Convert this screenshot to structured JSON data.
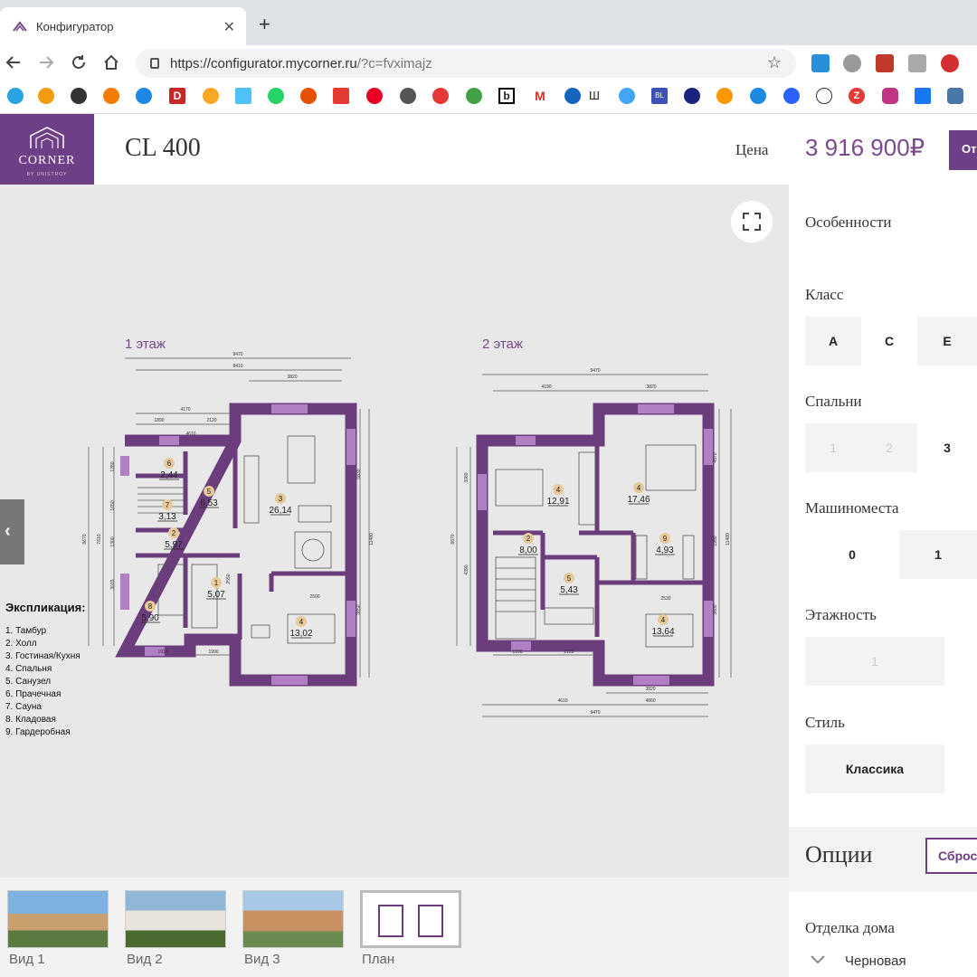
{
  "browser": {
    "tab_title": "Конфигуратор",
    "url_host": "https://configurator.mycorner.ru",
    "url_query": "/?c=fvximajz",
    "new_tab": "+",
    "close": "✕"
  },
  "bookmarks": {
    "letters": [
      "D",
      "b",
      "M",
      "Ш",
      "BL",
      "Z"
    ]
  },
  "header": {
    "logo_brand": "CORNER",
    "logo_by": "BY UNISTROY",
    "model": "CL 400",
    "price_label": "Цена",
    "price_value": "3 916 900₽",
    "send_button": "От"
  },
  "plan": {
    "floor1_label": "1 этаж",
    "floor2_label": "2 этаж",
    "floor1_rooms": [
      {
        "num": "6",
        "area": "2,44"
      },
      {
        "num": "5",
        "area": "6,53"
      },
      {
        "num": "3",
        "area": "26,14"
      },
      {
        "num": "7",
        "area": "3,13"
      },
      {
        "num": "2",
        "area": "5,97"
      },
      {
        "num": "1",
        "area": "5,07"
      },
      {
        "num": "8",
        "area": "5,90"
      },
      {
        "num": "4",
        "area": "13,02"
      }
    ],
    "floor2_rooms": [
      {
        "num": "4",
        "area": "12,91"
      },
      {
        "num": "4",
        "area": "17,46"
      },
      {
        "num": "2",
        "area": "8,00"
      },
      {
        "num": "5",
        "area": "5,43"
      },
      {
        "num": "9",
        "area": "4,93"
      },
      {
        "num": "4",
        "area": "13,64"
      }
    ],
    "floor1_dims": [
      "9470",
      "8410",
      "3820",
      "4170",
      "1890",
      "2120",
      "4610",
      "2550",
      "2500",
      "1910",
      "1990",
      "8670",
      "7610",
      "1280",
      "1650",
      "1300",
      "3015",
      "6630",
      "11480",
      "3650"
    ],
    "floor2_dims": [
      "9470",
      "4190",
      "3820",
      "3080",
      "4390",
      "8670",
      "4570",
      "1950",
      "11480",
      "3600",
      "1990",
      "2120",
      "2530",
      "3820",
      "4610",
      "4860",
      "9470"
    ],
    "explication_title": "Экспликация:",
    "explication": [
      "1. Тамбур",
      "2. Холл",
      "3. Гостиная/Кухня",
      "4. Спальня",
      "5. Санузел",
      "6. Прачечная",
      "7. Сауна",
      "8. Кладовая",
      "9. Гардеробная"
    ],
    "prev_arrow": "‹"
  },
  "thumbnails": [
    {
      "label": "Вид 1"
    },
    {
      "label": "Вид 2"
    },
    {
      "label": "Вид 3"
    },
    {
      "label": "План"
    }
  ],
  "sidebar": {
    "features_title": "Особенности",
    "class_title": "Класс",
    "class_options": [
      "A",
      "C",
      "E"
    ],
    "bedrooms_title": "Спальни",
    "bedrooms_options": [
      "1",
      "2",
      "3"
    ],
    "parking_title": "Машиноместа",
    "parking_options": [
      "0",
      "1"
    ],
    "floors_title": "Этажность",
    "floors_options": [
      "1"
    ],
    "style_title": "Стиль",
    "style_options": [
      "Классика"
    ],
    "options_title": "Опции",
    "reset_button": "Сброс",
    "finish_title": "Отделка дома",
    "finish_value": "Черновая"
  },
  "colors": {
    "accent": "#6e3e86",
    "wall": "#6b3d7d",
    "badge": "#e8c99a"
  }
}
